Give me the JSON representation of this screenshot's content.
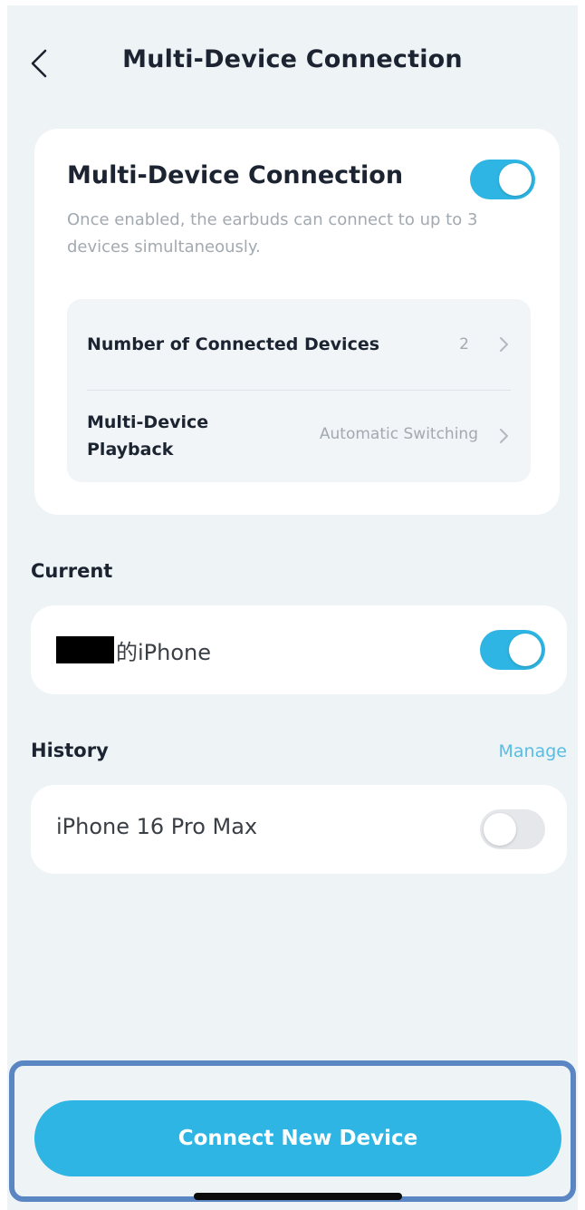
{
  "header": {
    "title": "Multi-Device Connection",
    "back_icon": "chevron-left-icon"
  },
  "multi_device": {
    "title": "Multi-Device Connection",
    "enabled": true,
    "description": "Once enabled, the earbuds can connect to up to 3 devices simultaneously.",
    "settings": [
      {
        "label": "Number of Connected Devices",
        "value": "2"
      },
      {
        "label": "Multi-Device Playback",
        "value": "Automatic Switching"
      }
    ]
  },
  "current": {
    "section_title": "Current",
    "device_name_suffix": "的iPhone",
    "connected": true
  },
  "history": {
    "section_title": "History",
    "manage_label": "Manage",
    "device_name": "iPhone 16 Pro Max",
    "connected": false
  },
  "footer": {
    "connect_button_label": "Connect New Device"
  },
  "colors": {
    "accent": "#2eb5e3",
    "background": "#eef3f6",
    "highlight_frame": "#5b86c4"
  }
}
